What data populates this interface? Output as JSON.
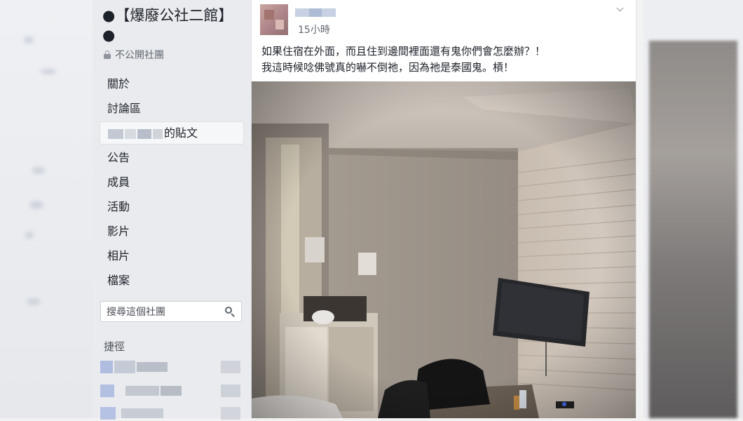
{
  "group": {
    "title": "●【爆廢公社二館】●",
    "privacy_label": "不公開社團"
  },
  "sidebar": {
    "items": [
      {
        "label": "關於"
      },
      {
        "label": "討論區"
      },
      {
        "label": "的貼文",
        "active": true
      },
      {
        "label": "公告"
      },
      {
        "label": "成員"
      },
      {
        "label": "活動"
      },
      {
        "label": "影片"
      },
      {
        "label": "相片"
      },
      {
        "label": "檔案"
      }
    ],
    "search_placeholder": "搜尋這個社團",
    "shortcuts_title": "捷徑"
  },
  "post": {
    "timestamp": "15小時",
    "text_line1": "如果住宿在外面，而且住到邊間裡面還有鬼你們會怎麼辦？！",
    "text_line2": "我這時候唸佛號真的嚇不倒祂，因為祂是泰國鬼。槓！"
  },
  "colors": {
    "sidebar_bg": "#e9ebee",
    "text": "#1d2129",
    "secondary_text": "#616770"
  }
}
